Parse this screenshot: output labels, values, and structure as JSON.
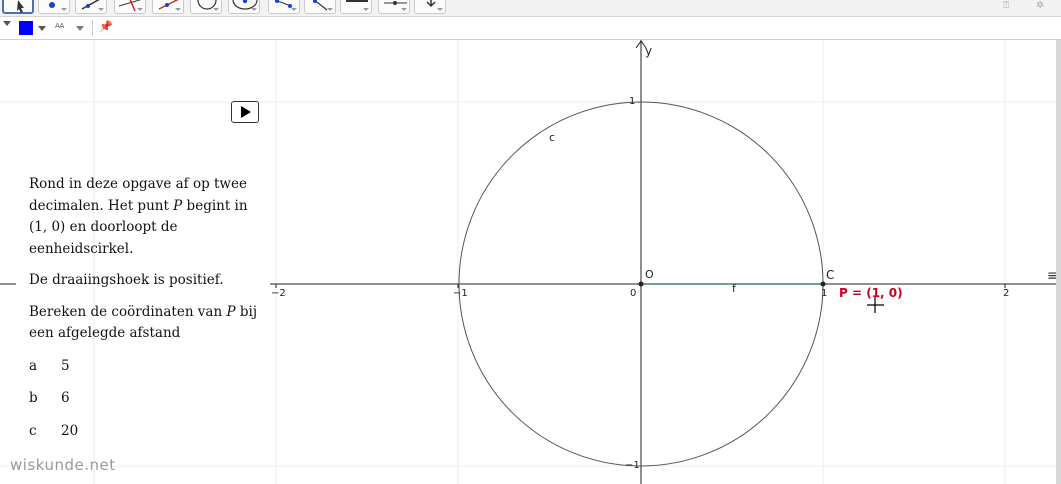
{
  "toolbar": {
    "tools": [
      {
        "icon": "move-arrow-icon",
        "active": true
      },
      {
        "icon": "point-icon"
      },
      {
        "icon": "line-icon"
      },
      {
        "icon": "perpendicular-line-icon"
      },
      {
        "icon": "polygon-icon"
      },
      {
        "icon": "circle-icon"
      },
      {
        "icon": "ellipse-icon"
      },
      {
        "icon": "angle-icon"
      },
      {
        "icon": "reflect-icon"
      },
      {
        "icon": "text-abc-icon"
      },
      {
        "icon": "slider-icon"
      },
      {
        "icon": "move-view-icon"
      }
    ],
    "help_icon": "help-icon",
    "settings_icon": "gear-icon"
  },
  "stylebar": {
    "color": "#0000ff",
    "font_size_label": "AA"
  },
  "task_text": {
    "p1_a": "Rond in deze opgave af op twee decimalen. Het punt ",
    "p1_p": "P",
    "p1_b": " begint in (1, 0) en doorloopt de eenheidscirkel.",
    "p2": "De draaiingshoek is positief.",
    "p3_a": "Bereken de coördinaten van ",
    "p3_p": "P",
    "p3_b": " bij een afgelegde afstand"
  },
  "questions": [
    {
      "letter": "a",
      "value": "5"
    },
    {
      "letter": "b",
      "value": "6"
    },
    {
      "letter": "c",
      "value": "20"
    }
  ],
  "watermark": "wiskunde.net",
  "graph": {
    "axis_label_y": "y",
    "x_ticks": [
      "−2",
      "−1",
      "0",
      "1",
      "2"
    ],
    "y_ticks": [
      "1",
      "−1"
    ],
    "circle_label": "c",
    "segment_label": "f",
    "origin_label": "O",
    "point_c_label": "C",
    "point_p_label": "P = (1, 0)",
    "colors": {
      "circle": "#555555",
      "segment": "#3d8a6a",
      "point_label": "#cc0022",
      "grid": "#e6e6e6"
    }
  }
}
